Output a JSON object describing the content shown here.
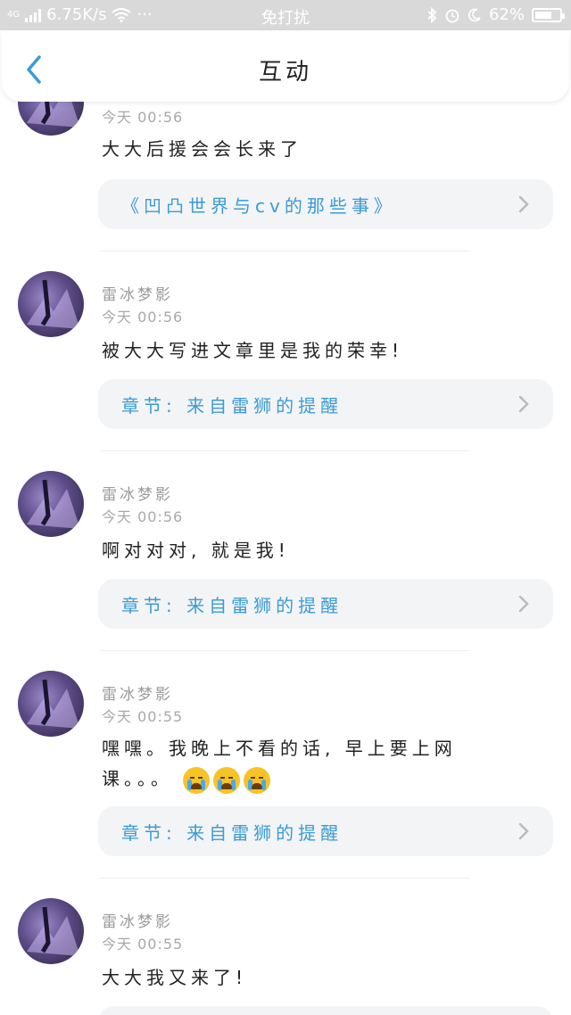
{
  "status_bar": {
    "network": "4G",
    "speed": "6.75K/s",
    "dots": "···",
    "mode": "免打扰",
    "battery": "62%"
  },
  "header": {
    "title": "互动"
  },
  "items": [
    {
      "time": "今天 00:56",
      "text": "大大后援会会长来了",
      "link": "《凹凸世界与cv的那些事》"
    },
    {
      "username": "雷冰梦影",
      "time": "今天 00:56",
      "text": "被大大写进文章里是我的荣幸!",
      "link": "章节: 来自雷狮的提醒"
    },
    {
      "username": "雷冰梦影",
      "time": "今天 00:56",
      "text": "啊对对对, 就是我!",
      "link": "章节: 来自雷狮的提醒"
    },
    {
      "username": "雷冰梦影",
      "time": "今天 00:55",
      "text_line1": "嘿嘿。我晚上不看的话, 早上要上网",
      "text_line2": "课。。。",
      "link": "章节: 来自雷狮的提醒"
    },
    {
      "username": "雷冰梦影",
      "time": "今天 00:55",
      "text": "大大我又来了!"
    }
  ],
  "icons": {
    "back": "chevron-left-icon",
    "link_arrow": "chevron-right-icon",
    "crying_emoji": "loudly-crying-face-icon"
  },
  "colors": {
    "accent": "#3b9bd6",
    "status_bar": "#d9d9d9",
    "card_bg": "#f3f4f6"
  }
}
